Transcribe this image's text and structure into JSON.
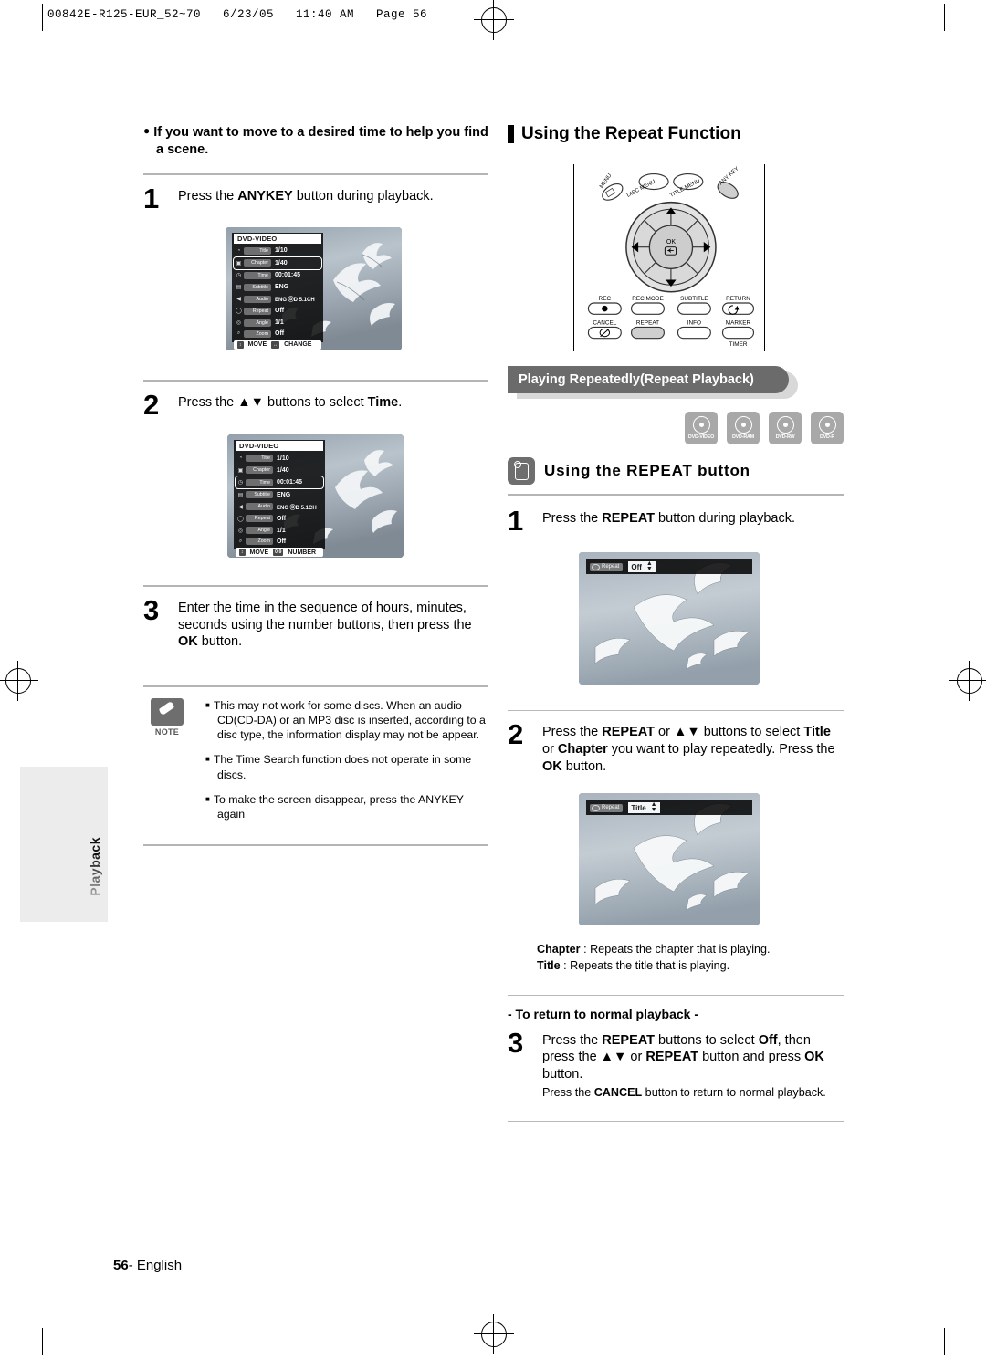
{
  "page_header": "00842E-R125-EUR_52~70   6/23/05   11:40 AM   Page 56",
  "footer": {
    "page_number": "56",
    "language": "- English"
  },
  "side_tab": {
    "label": "Playback"
  },
  "left_column": {
    "intro": "If you want to move to a desired time to help you find a scene.",
    "steps": [
      {
        "num": "1",
        "text_parts": [
          "Press the ",
          "ANYKEY",
          " button during playback."
        ]
      },
      {
        "num": "2",
        "text_parts": [
          "Press the ",
          "▲▼",
          " buttons to select ",
          "Time",
          "."
        ]
      },
      {
        "num": "3",
        "text_parts": [
          "Enter the time in the sequence of hours, minutes, seconds using the number buttons, then press the ",
          "OK",
          " button."
        ]
      }
    ],
    "step1_text_html": "Press the <b>ANYKEY</b> button during playback.",
    "step2_text_html": "Press the <b>▲▼</b> buttons to select <b>Time</b>.",
    "step3_text_html": "Enter the time in the sequence of hours, minutes, seconds using the number buttons, then press the <b>OK</b> button.",
    "osd_screen_1": {
      "title": "DVD-VIDEO",
      "selected_row": "Chapter",
      "footer_buttons": [
        "MOVE",
        "CHANGE"
      ],
      "rows": [
        {
          "label": "Title",
          "value": "1/10",
          "icon": "disc-icon"
        },
        {
          "label": "Chapter",
          "value": "1/40",
          "icon": "chapter-icon"
        },
        {
          "label": "Time",
          "value": "00:01:45",
          "icon": "clock-icon"
        },
        {
          "label": "Subtitle",
          "value": "ENG",
          "icon": "subtitle-icon"
        },
        {
          "label": "Audio",
          "value": "ENG ⒹD 5.1CH",
          "icon": "speaker-icon"
        },
        {
          "label": "Repeat",
          "value": "Off",
          "icon": "repeat-icon"
        },
        {
          "label": "Angle",
          "value": "1/1",
          "icon": "angle-icon"
        },
        {
          "label": "Zoom",
          "value": "Off",
          "icon": "zoom-icon"
        }
      ]
    },
    "osd_screen_2": {
      "title": "DVD-VIDEO",
      "selected_row": "Time",
      "footer_buttons": [
        "MOVE",
        "NUMBER"
      ],
      "rows": [
        {
          "label": "Title",
          "value": "1/10",
          "icon": "disc-icon"
        },
        {
          "label": "Chapter",
          "value": "1/40",
          "icon": "chapter-icon"
        },
        {
          "label": "Time",
          "value": "00:01:45",
          "icon": "clock-icon"
        },
        {
          "label": "Subtitle",
          "value": "ENG",
          "icon": "subtitle-icon"
        },
        {
          "label": "Audio",
          "value": "ENG ⒹD 5.1CH",
          "icon": "speaker-icon"
        },
        {
          "label": "Repeat",
          "value": "Off",
          "icon": "repeat-icon"
        },
        {
          "label": "Angle",
          "value": "1/1",
          "icon": "angle-icon"
        },
        {
          "label": "Zoom",
          "value": "Off",
          "icon": "zoom-icon"
        }
      ]
    },
    "note": {
      "label": "NOTE",
      "items": [
        "This may not work for some discs. When an audio CD(CD-DA) or an MP3 disc is inserted, according to a disc type, the information display may not be appear.",
        "The Time Search function does not operate in some discs.",
        "To make the screen disappear, press the ANYKEY again"
      ]
    }
  },
  "right_column": {
    "section_title": "Using the Repeat Function",
    "banner": "Playing Repeatedly(Repeat Playback)",
    "disc_types": [
      "DVD-VIDEO",
      "DVD-RAM",
      "DVD-RW",
      "DVD-R"
    ],
    "subsection_title": "Using the REPEAT button",
    "remote": {
      "top_labels": [
        "MENU",
        "DISC MENU",
        "TITLE MENU",
        "ANY KEY"
      ],
      "ok_label": "OK",
      "row1": [
        "REC",
        "REC MODE",
        "SUBTITLE",
        "RETURN"
      ],
      "row2": [
        "CANCEL",
        "REPEAT",
        "INFO",
        "MARKER"
      ],
      "row3": [
        "TIMER"
      ]
    },
    "step1_html": "Press the <b>REPEAT</b> button during playback.",
    "step2_html": "Press the <b>REPEAT</b> or <b>▲▼</b> buttons to select <b>Title</b> or <b>Chapter</b> you want to play repeatedly. Press the <b>OK</b> button.",
    "repeat_osd_1": {
      "label": "Repeat",
      "value": "Off"
    },
    "repeat_osd_2": {
      "label": "Repeat",
      "value": "Title"
    },
    "definitions_html": "<b>Chapter</b> : Repeats the chapter that is playing.<br><b>Title</b> : Repeats the title that is playing.",
    "return_heading": "- To return to normal playback -",
    "step3_html": "Press the <b>REPEAT</b> buttons to select <b>Off</b>, then press the <b>▲▼</b> or <b>REPEAT</b> button and press <b>OK</b> button.",
    "step3_sub_html": "Press the <b>CANCEL</b> button to return to normal playback.",
    "step_numbers": {
      "one": "1",
      "two": "2",
      "three": "3"
    }
  }
}
